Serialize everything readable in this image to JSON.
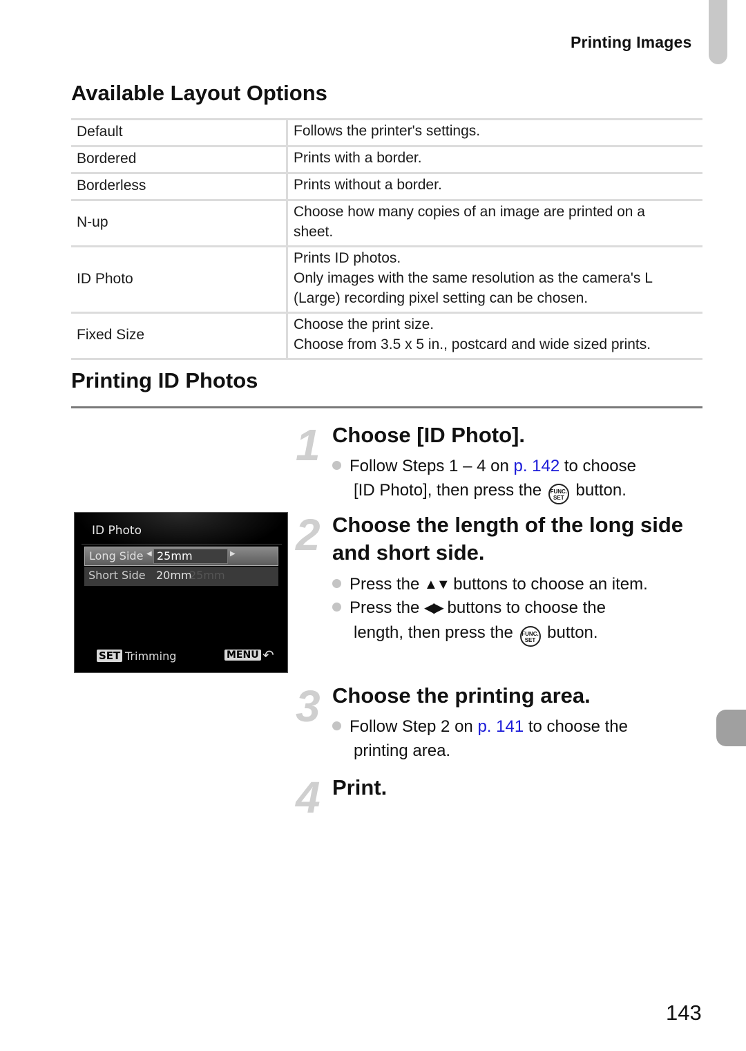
{
  "header": {
    "section_label": "Printing Images"
  },
  "layout_options": {
    "heading": "Available Layout Options",
    "rows": [
      {
        "option": "Default",
        "description": [
          "Follows the printer's settings."
        ]
      },
      {
        "option": "Bordered",
        "description": [
          "Prints with a border."
        ]
      },
      {
        "option": "Borderless",
        "description": [
          "Prints without a border."
        ]
      },
      {
        "option": "N-up",
        "description": [
          "Choose how many copies of an image are printed on a",
          "sheet."
        ]
      },
      {
        "option": "ID Photo",
        "description": [
          "Prints ID photos.",
          "Only images with the same resolution as the camera's L",
          "(Large) recording pixel setting can be chosen."
        ]
      },
      {
        "option": "Fixed Size",
        "description": [
          "Choose the print size.",
          "Choose from 3.5 x 5 in., postcard and wide sized prints."
        ]
      }
    ]
  },
  "id_photos": {
    "heading": "Printing ID Photos",
    "steps": [
      {
        "number": "1",
        "title": "Choose [ID Photo].",
        "bullets": [
          {
            "pre": "Follow Steps 1 – 4 on ",
            "link": "p. 142",
            "post": " to choose",
            "line2_pre": "[ID Photo], then press the ",
            "line2_post": " button."
          }
        ]
      },
      {
        "number": "2",
        "title_line1": "Choose the length of the long side",
        "title_line2": "and short side.",
        "bullets": [
          {
            "pre": "Press the ",
            "icon": "▲▼",
            "post": " buttons to choose an item."
          },
          {
            "pre": "Press the ",
            "icon": "◀▶",
            "post": " buttons to choose the",
            "line2_pre": "length, then press the ",
            "line2_post": " button."
          }
        ]
      },
      {
        "number": "3",
        "title": "Choose the printing area.",
        "bullets": [
          {
            "pre": "Follow Step 2 on ",
            "link": "p. 141",
            "post": " to choose the",
            "line2": "printing area."
          }
        ]
      },
      {
        "number": "4",
        "title": "Print."
      }
    ]
  },
  "func_icon": {
    "line1": "FUNC.",
    "line2": "SET"
  },
  "camera_screen": {
    "title": "ID Photo",
    "rows": [
      {
        "label": "Long Side",
        "value": "25mm",
        "selected": true
      },
      {
        "label": "Short Side",
        "value": "20mm",
        "ghost": "25mm"
      }
    ],
    "footer_left_key": "SET",
    "footer_left_label": "Trimming",
    "footer_right_key": "MENU",
    "back_icon": "⮌"
  },
  "page_number": "143",
  "colors": {
    "link": "#1a1ad8",
    "step_number": "#cfcfcf",
    "tab_gray": "#a0a0a0"
  }
}
